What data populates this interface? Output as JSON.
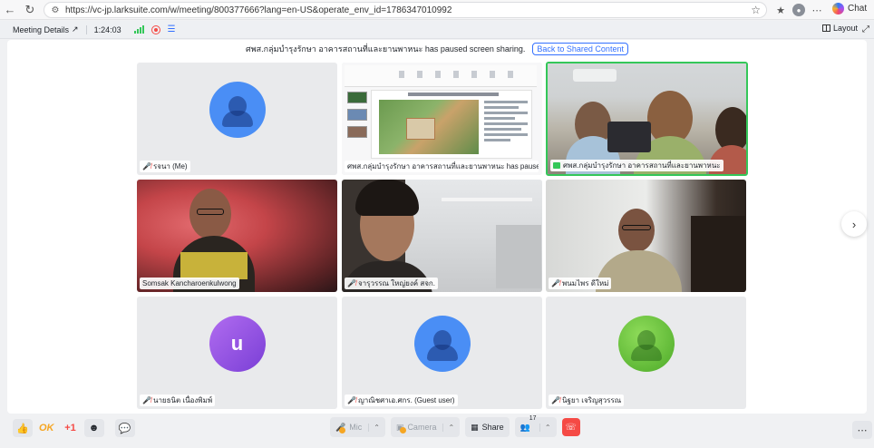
{
  "browser": {
    "url": "https://vc-jp.larksuite.com/w/meeting/800377666?lang=en-US&operate_env_id=1786347010992",
    "chat_label": "Chat"
  },
  "meeting_bar": {
    "details_label": "Meeting Details",
    "duration": "1:24:03",
    "layout_label": "Layout"
  },
  "notice": {
    "text": "ศพส.กลุ่มบำรุงรักษา อาคารสถานที่และยานพาหนะ has paused screen sharing.",
    "back_button": "Back to Shared Content"
  },
  "tiles": [
    {
      "name": "รจนา (Me)",
      "mic_muted": true,
      "type": "avatar"
    },
    {
      "name": "ศพส.กลุ่มบำรุงรักษา อาคารสถานที่และยานพาหนะ has paused scre...",
      "mic_muted": false,
      "type": "screen"
    },
    {
      "name": "ศพส.กลุ่มบำรุงรักษา อาคารสถานที่และยานพาหนะ",
      "mic_muted": false,
      "type": "video",
      "sharing": true,
      "active_speaker": true
    },
    {
      "name": "Somsak Kancharoenkulwong",
      "mic_muted": false,
      "type": "video"
    },
    {
      "name": "จารุวรรณ ใหญ่ยงค์ สจก.",
      "mic_muted": true,
      "type": "video"
    },
    {
      "name": "พนมไพร ดีใหม่",
      "mic_muted": true,
      "type": "video"
    },
    {
      "name": "นายธนิต เนื่องพิมพ์",
      "mic_muted": true,
      "type": "avatar",
      "letter": "u"
    },
    {
      "name": "ญาณิชศาเอ.ศกร. (Guest user)",
      "mic_muted": true,
      "type": "avatar"
    },
    {
      "name": "นิฐยา เจริญสุวรรณ",
      "mic_muted": true,
      "type": "avatar"
    }
  ],
  "toolbar": {
    "reaction_ok": "OK",
    "reaction_plus": "+1",
    "mic_label": "Mic",
    "camera_label": "Camera",
    "share_label": "Share",
    "participants_count": "17"
  },
  "colors": {
    "accent": "#3370ff",
    "danger": "#f54a45",
    "active_border": "#34c759"
  }
}
